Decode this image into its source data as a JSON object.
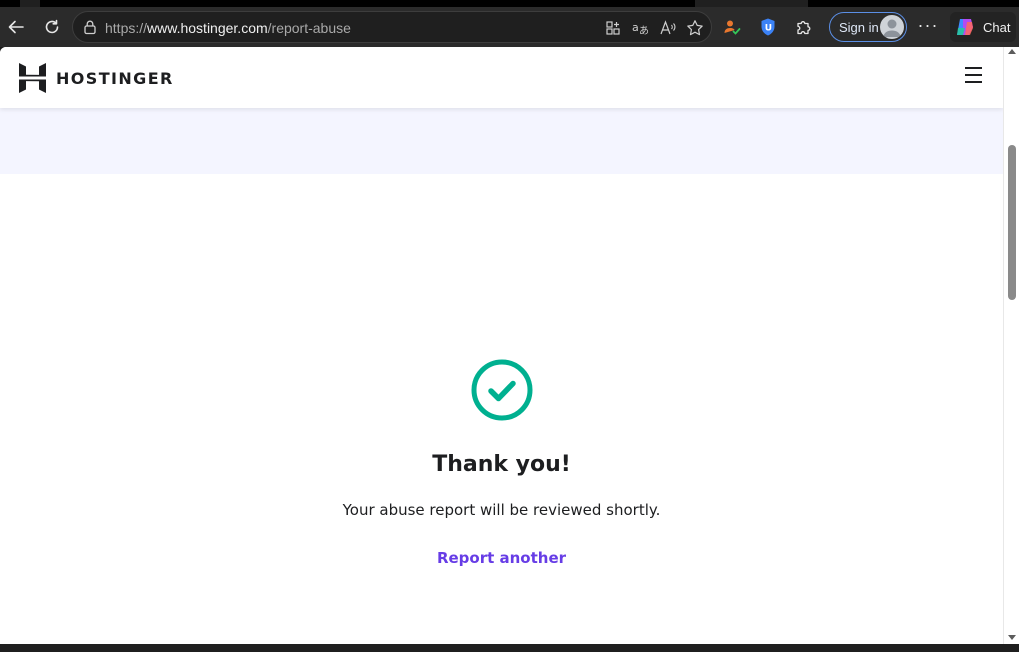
{
  "browser": {
    "url_prefix": "https://",
    "url_host": "www.hostinger.com",
    "url_path": "/report-abuse",
    "signin_label": "Sign in",
    "more_label": "···",
    "chat_label": "Chat"
  },
  "site": {
    "logo_text": "HOSTINGER"
  },
  "success": {
    "title": "Thank you!",
    "message": "Your abuse report will be reviewed shortly.",
    "link_label": "Report another"
  },
  "colors": {
    "brand_purple": "#673de6",
    "success_green": "#00b090",
    "hero_band": "#f4f5ff"
  }
}
